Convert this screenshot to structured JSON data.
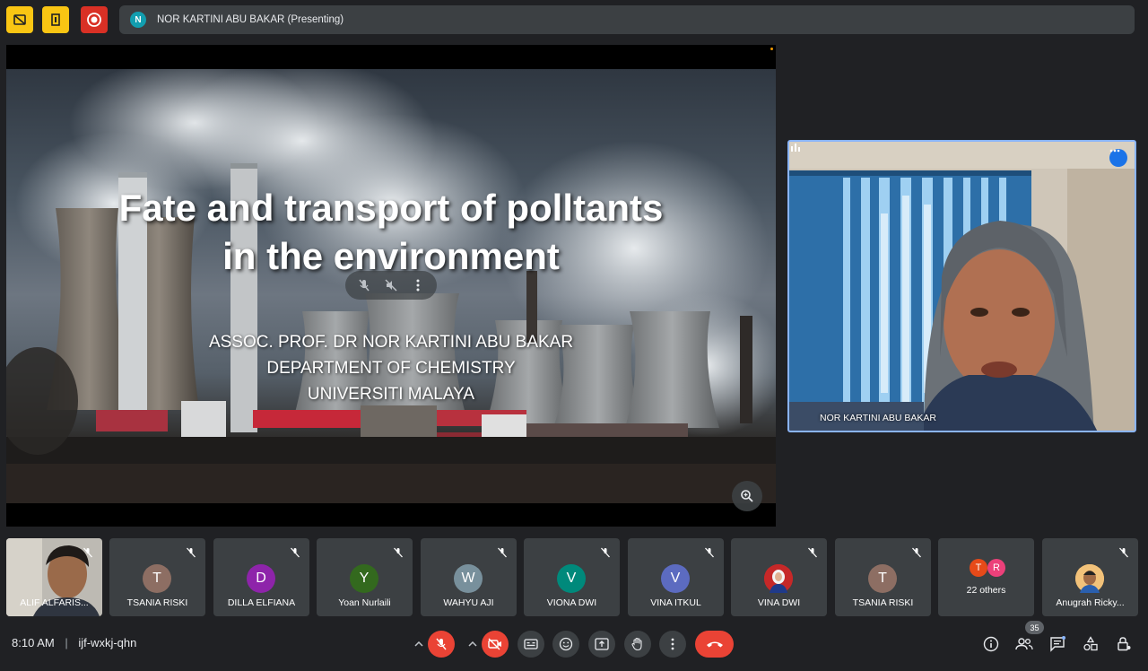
{
  "top_bar": {
    "presenter_initial": "N",
    "presenting_label": "NOR KARTINI ABU BAKAR (Presenting)"
  },
  "slide": {
    "title_line1": "Fate and transport of polltants",
    "title_line2": "in the environment",
    "author": "ASSOC. PROF. DR NOR KARTINI ABU BAKAR",
    "department": "DEPARTMENT OF CHEMISTRY",
    "university": "UNIVERSITI MALAYA"
  },
  "presenter": {
    "name": "NOR KARTINI ABU BAKAR"
  },
  "participants": [
    {
      "name": "ALIF ALFARIS...",
      "initial": "",
      "color": "",
      "video": true
    },
    {
      "name": "TSANIA RISKI",
      "initial": "T",
      "color": "#8d6e63"
    },
    {
      "name": "DILLA ELFIANA",
      "initial": "D",
      "color": "#8e24aa"
    },
    {
      "name": "Yoan Nurlaili",
      "initial": "Y",
      "color": "#33691e"
    },
    {
      "name": "WAHYU AJI",
      "initial": "W",
      "color": "#78909c"
    },
    {
      "name": "VIONA DWI",
      "initial": "V",
      "color": "#00897b"
    },
    {
      "name": "VINA ITKUL",
      "initial": "V",
      "color": "#5c6bc0"
    },
    {
      "name": "VINA DWI",
      "initial": "",
      "color": "#c62828"
    },
    {
      "name": "TSANIA RISKI",
      "initial": "T",
      "color": "#8d6e63"
    },
    {
      "name": "22 others",
      "initial_a": "T",
      "initial_b": "R",
      "color_a": "#e64a19",
      "color_b": "#ec407a"
    },
    {
      "name": "Anugrah Ricky...",
      "initial": "",
      "color": "#ffb74d"
    }
  ],
  "bottom_bar": {
    "time": "8:10 AM",
    "separator": "|",
    "meeting_code": "ijf-wxkj-qhn",
    "participant_count": "35"
  },
  "colors": {
    "background": "#202124",
    "tile": "#3c4043",
    "danger": "#ea4335",
    "accent": "#8ab4f8"
  }
}
